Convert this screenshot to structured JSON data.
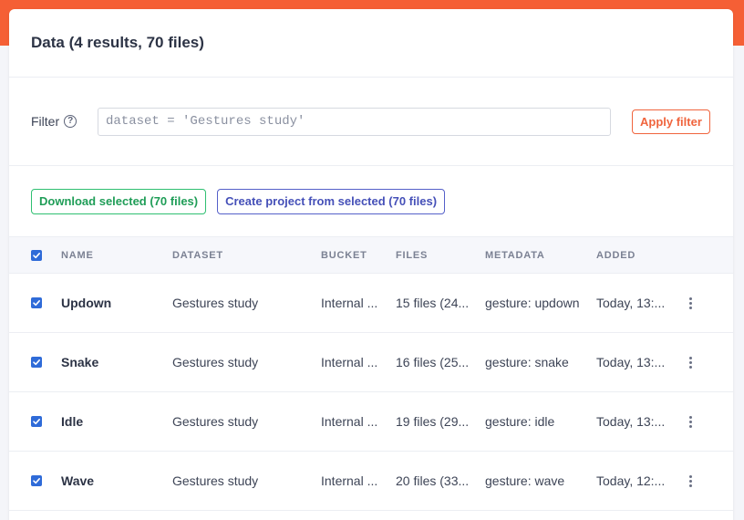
{
  "header": {
    "title": "Data (4 results, 70 files)"
  },
  "filter": {
    "label": "Filter",
    "help_icon": "question-circle-icon",
    "placeholder": "dataset = 'Gestures study'",
    "value": "",
    "apply_label": "Apply filter"
  },
  "actions": {
    "download_label": "Download selected (70 files)",
    "create_project_label": "Create project from selected (70 files)"
  },
  "table": {
    "columns": [
      "NAME",
      "DATASET",
      "BUCKET",
      "FILES",
      "METADATA",
      "ADDED"
    ],
    "select_all_checked": true,
    "rows": [
      {
        "checked": true,
        "name": "Updown",
        "dataset": "Gestures study",
        "bucket": "Internal ...",
        "files": "15 files (24...",
        "metadata": "gesture: updown",
        "added": "Today, 13:..."
      },
      {
        "checked": true,
        "name": "Snake",
        "dataset": "Gestures study",
        "bucket": "Internal ...",
        "files": "16 files (25...",
        "metadata": "gesture: snake",
        "added": "Today, 13:..."
      },
      {
        "checked": true,
        "name": "Idle",
        "dataset": "Gestures study",
        "bucket": "Internal ...",
        "files": "19 files (29...",
        "metadata": "gesture: idle",
        "added": "Today, 13:..."
      },
      {
        "checked": true,
        "name": "Wave",
        "dataset": "Gestures study",
        "bucket": "Internal ...",
        "files": "20 files (33...",
        "metadata": "gesture: wave",
        "added": "Today, 12:..."
      }
    ]
  },
  "colors": {
    "brand_orange": "#f55f35",
    "checkbox_blue": "#2f6bd8",
    "download_green": "#2fbf71",
    "project_blue": "#5560c9"
  }
}
